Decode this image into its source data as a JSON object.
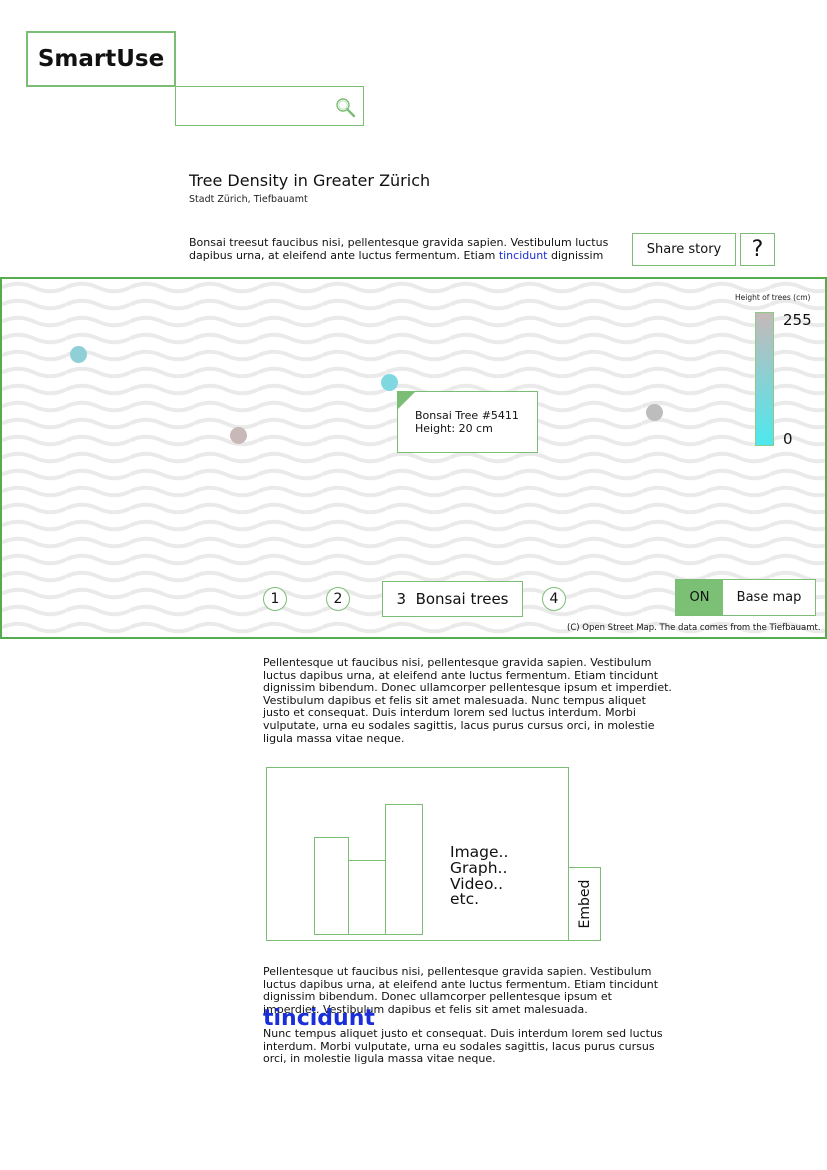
{
  "app": {
    "logo_text": "SmartUse"
  },
  "search": {
    "placeholder": "",
    "icon": "search-icon"
  },
  "story": {
    "title": "Tree Density in Greater Zürich",
    "subtitle": "Stadt Zürich, Tiefbauamt",
    "intro_before_link": "Bonsai treesut faucibus nisi, pellentesque gravida sapien. Vestibulum luctus dapibus urna, at eleifend ante luctus fermentum. Etiam ",
    "intro_link": "tincidunt",
    "intro_after_link": " dignissim",
    "share_label": "Share story",
    "help_label": "?"
  },
  "map": {
    "legend_title": "Height of trees (cm)",
    "legend_max": "255",
    "legend_min": "0",
    "legend_colors": {
      "max": "#c5b8b8",
      "min": "#4de8ee"
    },
    "points": [
      {
        "color": "#8fd0d8"
      },
      {
        "color": "#c8b8b8"
      },
      {
        "color": "#7fd8e0"
      },
      {
        "color": "#bdbdbd"
      }
    ],
    "tooltip": {
      "line1": "Bonsai Tree #5411",
      "line2": "Height: 20 cm"
    },
    "pagination": [
      {
        "label": "1"
      },
      {
        "label": "2"
      },
      {
        "label": "3  Bonsai trees"
      },
      {
        "label": "4"
      }
    ],
    "toggle": {
      "state": "ON",
      "label": "Base map"
    },
    "attribution": "(C) Open Street Map. The data comes from the Tiefbauamt."
  },
  "body": {
    "paragraph1": "Pellentesque ut faucibus nisi, pellentesque gravida sapien. Vestibulum luctus dapibus urna, at eleifend ante luctus fermentum. Etiam tincidunt dignissim bibendum. Donec ullamcorper pellentesque ipsum et imperdiet. Vestibulum dapibus et felis sit amet malesuada. Nunc tempus aliquet justo et consequat. Duis interdum lorem sed luctus interdum. Morbi vulputate, urna eu sodales sagittis, lacus purus cursus orci, in molestie ligula massa vitae neque.",
    "media_lines": [
      "Image..",
      "Graph..",
      "Video..",
      "etc."
    ],
    "embed_label": "Embed",
    "paragraph2": "Pellentesque ut faucibus nisi, pellentesque gravida sapien. Vestibulum luctus dapibus urna, at eleifend ante luctus fermentum. Etiam tincidunt dignissim bibendum. Donec ullamcorper pellentesque ipsum et imperdiet. Vestibulum dapibus et felis sit amet malesuada.",
    "floating_word": "tincidunt",
    "paragraph3": "Nunc tempus aliquet justo et consequat. Duis interdum lorem sed luctus interdum. Morbi vulputate, urna eu sodales sagittis, lacus purus cursus orci, in molestie ligula massa vitae neque."
  },
  "colors": {
    "accent": "#7bbd74",
    "map_border": "#56ab4e",
    "link": "#1a2fd8",
    "toggle_on": "#7bc075"
  }
}
